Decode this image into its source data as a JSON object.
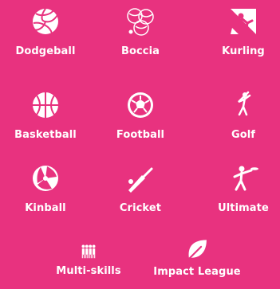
{
  "sports": [
    {
      "label": "Dodgeball",
      "icon": "volleyball-icon"
    },
    {
      "label": "Boccia",
      "icon": "boccia-balls-icon"
    },
    {
      "label": "Kurling",
      "icon": "climber-icon"
    },
    {
      "label": "Basketball",
      "icon": "basketball-icon"
    },
    {
      "label": "Football",
      "icon": "football-icon"
    },
    {
      "label": "Golf",
      "icon": "golfer-icon"
    },
    {
      "label": "Kinball",
      "icon": "beach-ball-icon"
    },
    {
      "label": "Cricket",
      "icon": "cricket-bat-icon"
    },
    {
      "label": "Ultimate",
      "icon": "frisbee-thrower-icon"
    },
    {
      "label": "Multi-skills",
      "icon": "group-icon"
    },
    {
      "label": "Impact League",
      "icon": "leaf-icon"
    }
  ],
  "colors": {
    "background": "#e8327f",
    "foreground": "#ffffff"
  }
}
